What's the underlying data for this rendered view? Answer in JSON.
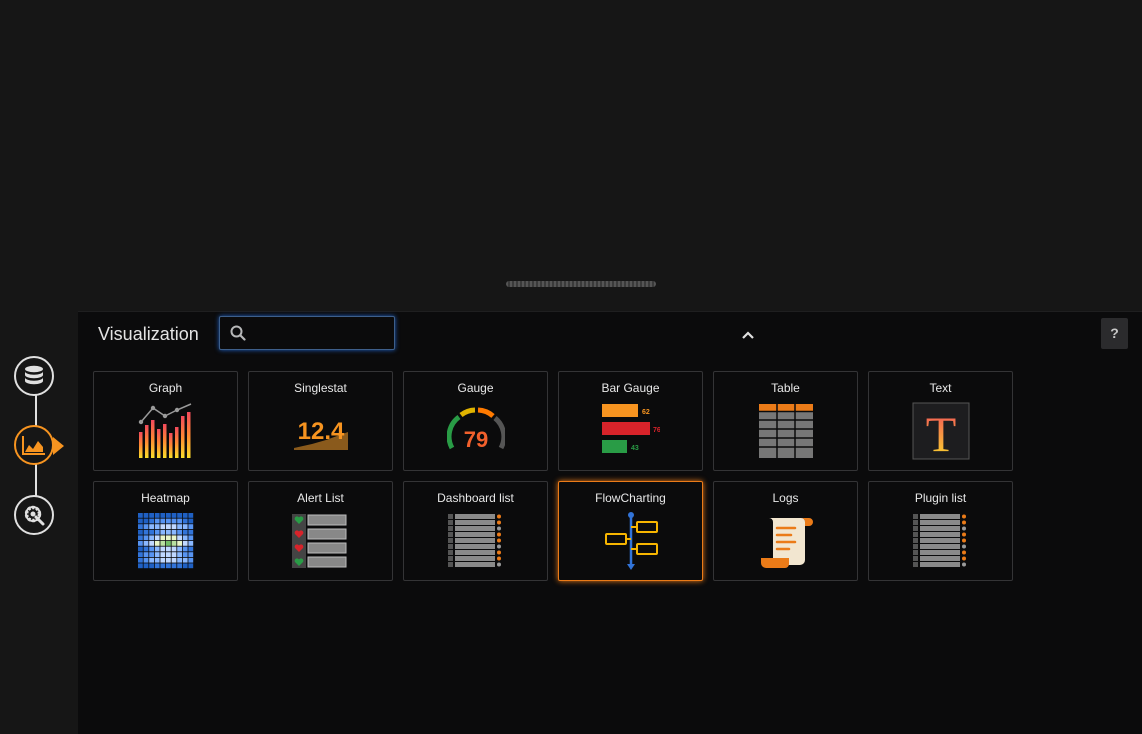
{
  "editor": {
    "title": "Visualization",
    "search": {
      "value": "",
      "placeholder": ""
    },
    "help_label": "?"
  },
  "sidebar": {
    "steps": [
      {
        "icon": "database-icon"
      },
      {
        "icon": "visualization-chart-icon",
        "active": true
      },
      {
        "icon": "settings-gear-icon"
      }
    ]
  },
  "plugins": [
    {
      "name": "Graph",
      "icon": "graph-icon"
    },
    {
      "name": "Singlestat",
      "icon": "singlestat-icon",
      "value_text": "12.4"
    },
    {
      "name": "Gauge",
      "icon": "gauge-icon",
      "value_text": "79"
    },
    {
      "name": "Bar Gauge",
      "icon": "bar-gauge-icon",
      "bar_values": [
        "62",
        "76",
        "43"
      ]
    },
    {
      "name": "Table",
      "icon": "table-icon"
    },
    {
      "name": "Text",
      "icon": "text-icon",
      "glyph": "T"
    },
    {
      "name": "Heatmap",
      "icon": "heatmap-icon"
    },
    {
      "name": "Alert List",
      "icon": "alert-list-icon"
    },
    {
      "name": "Dashboard list",
      "icon": "dashboard-list-icon"
    },
    {
      "name": "FlowCharting",
      "icon": "flowcharting-icon",
      "selected": true
    },
    {
      "name": "Logs",
      "icon": "logs-icon"
    },
    {
      "name": "Plugin list",
      "icon": "plugin-list-icon"
    }
  ],
  "colors": {
    "accent": "#f79420",
    "selected_border": "#eb7b18",
    "search_focus": "#3e5f8a"
  }
}
